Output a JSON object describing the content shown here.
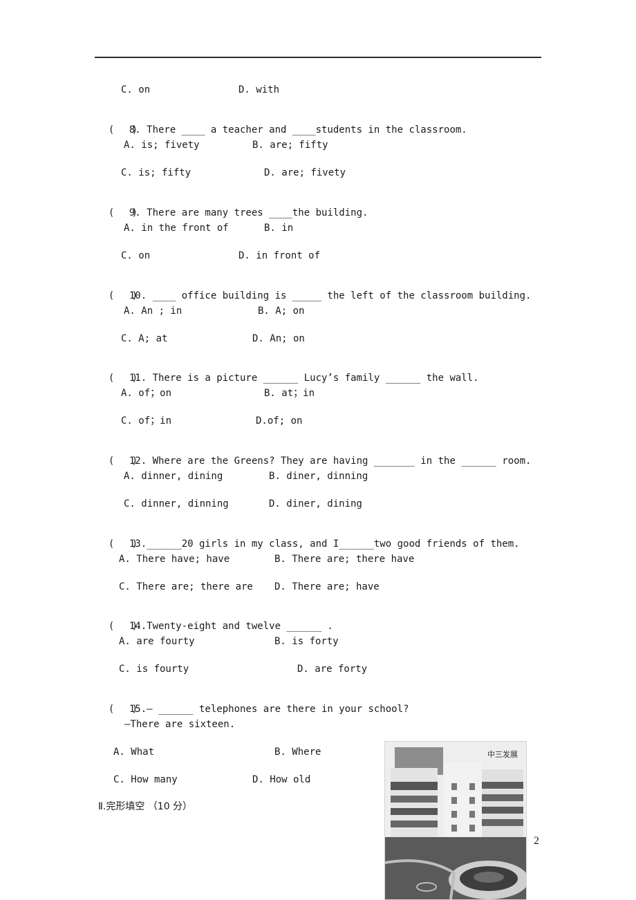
{
  "document": {
    "page_number": "2",
    "section_heading": "Ⅱ.完形填空 （10 分）",
    "questions": [
      {
        "id": "q7_tail",
        "options": {
          "C": "C. on",
          "D": "D. with"
        }
      },
      {
        "id": "q8",
        "paren": "(   )",
        "text": "8. There ____ a teacher and ____students in the classroom.",
        "options": {
          "A": "A. is; fivety",
          "B": "B. are; fifty",
          "C": "C. is; fifty",
          "D": "D. are; fivety"
        }
      },
      {
        "id": "q9",
        "paren": "(   )",
        "text": "9. There are many trees ____the building.",
        "options": {
          "A": "A. in the front of",
          "B": "B. in",
          "C": "C. on",
          "D": "D. in front of"
        }
      },
      {
        "id": "q10",
        "paren": "(   )",
        "text": "10. ____ office building is _____ the left of the classroom building.",
        "options": {
          "A": "A. An ; in",
          "B": "B. A; on",
          "C": "C. A; at",
          "D": "D. An; on"
        }
      },
      {
        "id": "q11",
        "paren": "(   )",
        "text": "11. There is a picture ______ Lucy’s family ______ the wall.",
        "options": {
          "A": "A. of；on",
          "B": "B. at；in",
          "C": "C. of；in",
          "D": "D.of; on"
        }
      },
      {
        "id": "q12",
        "paren": "(   )",
        "text": "12. Where are the Greens? They are having _______ in the ______ room.",
        "options": {
          "A": "A. dinner, dining",
          "B": "B. diner, dinning",
          "C": "C. dinner, dinning",
          "D": "D. diner, dining"
        }
      },
      {
        "id": "q13",
        "paren": "(   )",
        "text": "13.______20 girls in my class, and I______two good friends of them.",
        "options": {
          "A": "A. There have; have",
          "B": "B. There are; there have",
          "C": "C. There are; there are",
          "D": "D. There are; have"
        }
      },
      {
        "id": "q14",
        "paren": "(   )",
        "text": "14.Twenty-eight and twelve ______ .",
        "options": {
          "A": "A. are fourty",
          "B": "B. is forty",
          "C": "C. is fourty",
          "D": "D. are forty"
        }
      },
      {
        "id": "q15",
        "paren": "(   )",
        "text": "15.— ______ telephones are there in your school?",
        "answer_line": "—There are sixteen.",
        "options": {
          "A": "A. What",
          "B": "B. Where",
          "C": "C. How many",
          "D": "D. How old"
        }
      }
    ],
    "image": {
      "description": "photo of school building courtyard",
      "sign_text": "中三发展"
    }
  }
}
